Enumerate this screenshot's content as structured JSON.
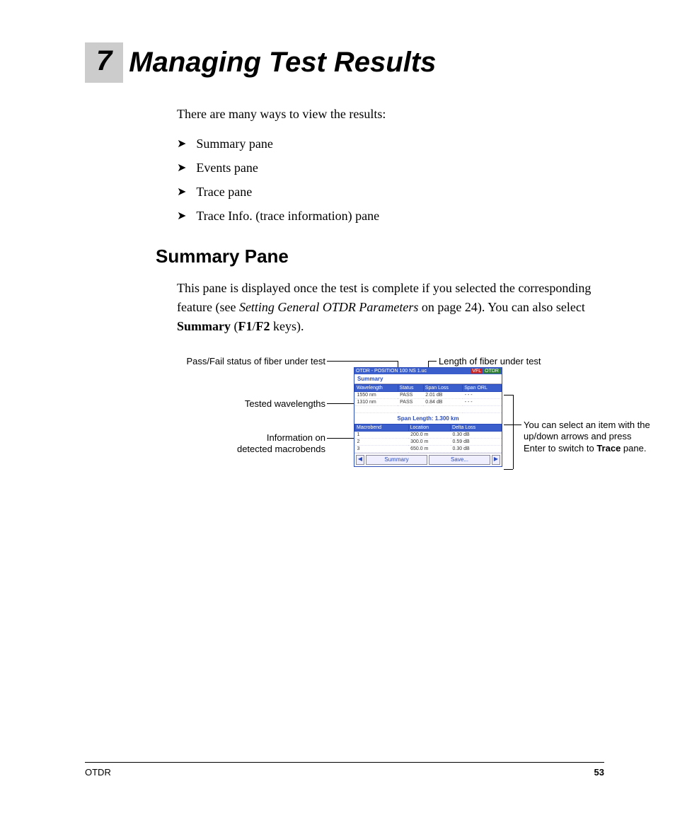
{
  "chapter": {
    "number": "7",
    "title": "Managing Test Results"
  },
  "intro": "There are many ways to view the results:",
  "bullets": [
    "Summary pane",
    "Events pane",
    "Trace pane",
    "Trace Info. (trace information) pane"
  ],
  "section_h2": "Summary Pane",
  "para_parts": {
    "p1a": "This pane is displayed once the test is complete if you selected the corresponding feature (see ",
    "p1_em": "Setting General OTDR Parameters",
    "p1b": " on page 24). You can also select ",
    "p1_strong1": "Summary",
    "p1c": " (",
    "p1_strong2": "F1",
    "p1d": "/",
    "p1_strong3": "F2",
    "p1e": " keys)."
  },
  "callouts": {
    "c_passfail": "Pass/Fail status of fiber under test",
    "c_length": "Length of fiber under test",
    "c_wavelengths": "Tested wavelengths",
    "c_macro_l1": "Information on",
    "c_macro_l2": "detected macrobends",
    "c_select_l1": "You can select an item with the",
    "c_select_l2": "up/down arrows and press",
    "c_select_l3a": "Enter to switch to ",
    "c_select_l3b": "Trace",
    "c_select_l3c": " pane."
  },
  "device": {
    "title_left": "OTDR - POSITION 100 NS 1.uc",
    "vfl": "VFL",
    "otdr": "OTDR",
    "tab": "Summary",
    "th": [
      "Wavelength",
      "Status",
      "Span Loss",
      "Span ORL"
    ],
    "rows": [
      [
        "1550 nm",
        "PASS",
        "2.01 dB",
        "- - -"
      ],
      [
        "1310 nm",
        "PASS",
        "0.84 dB",
        "- - -"
      ]
    ],
    "span_length": "Span Length: 1.300 km",
    "th2": [
      "Macrobend",
      "Location",
      "Delta Loss"
    ],
    "rows2": [
      [
        "1",
        "200.0 m",
        "0.30 dB"
      ],
      [
        "2",
        "300.0 m",
        "0.59 dB"
      ],
      [
        "3",
        "650.0 m",
        "0.30 dB"
      ]
    ],
    "btn_left": "◀",
    "btn_summary": "Summary",
    "btn_save": "Save...",
    "btn_right": "▶"
  },
  "footer": {
    "left": "OTDR",
    "page": "53"
  }
}
